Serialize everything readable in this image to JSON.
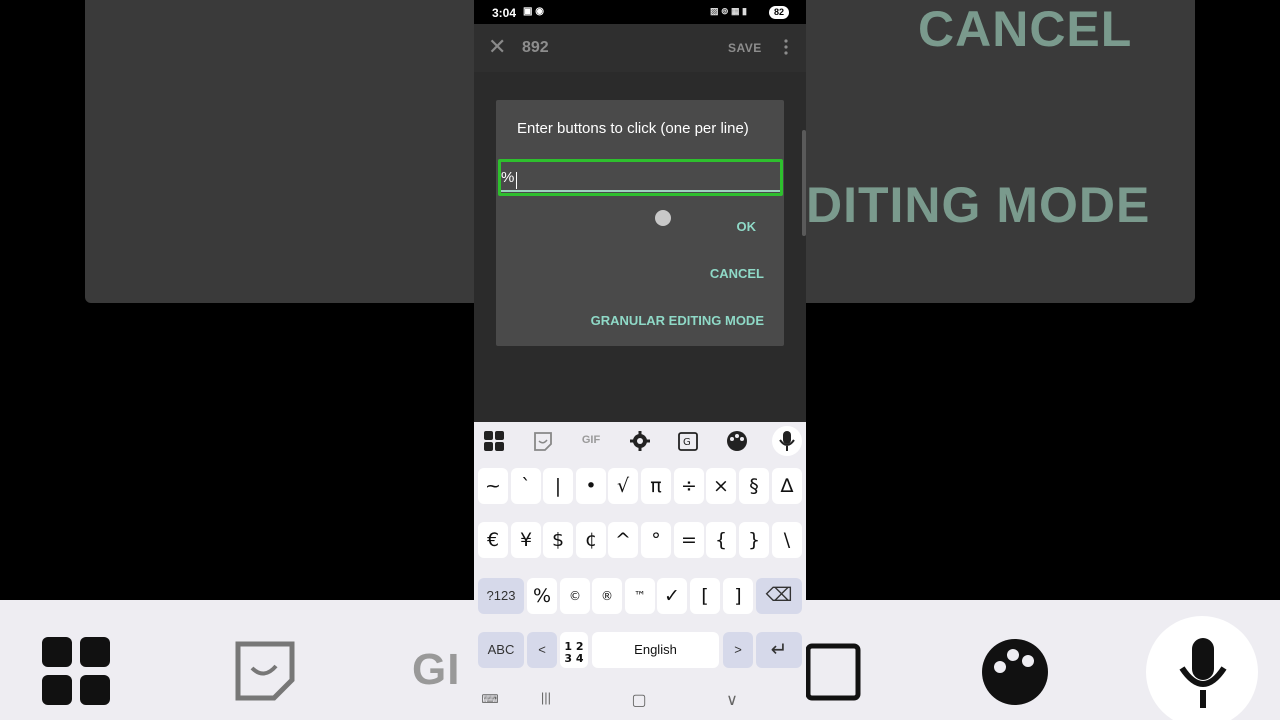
{
  "status_bar": {
    "time": "3:04",
    "left_icons": "▣ ◉",
    "right_icons": "▨ ⊚ ▦ ▮",
    "battery": "82"
  },
  "app_bar": {
    "close_glyph": "✕",
    "title": "892",
    "save_label": "SAVE",
    "more_glyph": "⋮"
  },
  "dialog": {
    "title": "Enter buttons to click (one per line)",
    "input_value": "%",
    "ok_label": "OK",
    "cancel_label": "CANCEL",
    "granular_label": "GRANULAR EDITING MODE",
    "accent_color": "#8fd9c7",
    "focus_color": "#2ec02e"
  },
  "background": {
    "cancel_text": "CANCEL",
    "editing_text": "DITING MODE"
  },
  "keyboard": {
    "toolbar": {
      "gif_label": "GIF"
    },
    "row1": [
      "~",
      "`",
      "|",
      "•",
      "√",
      "π",
      "÷",
      "×",
      "§",
      "∆"
    ],
    "row2": [
      "€",
      "¥",
      "$",
      "¢",
      "^",
      "°",
      "=",
      "{",
      "}",
      "\\"
    ],
    "row3": {
      "mode_label": "?123",
      "keys": [
        "%",
        "©",
        "®",
        "™",
        "✓",
        "[",
        "]"
      ],
      "backspace_glyph": "⌫"
    },
    "row4": {
      "abc_label": "ABC",
      "left_label": "<",
      "stack_top": "1 2",
      "stack_bottom": "3 4",
      "space_label": "English",
      "right_label": ">",
      "enter_glyph": "↵"
    }
  },
  "nav_bar": {
    "keyboard_glyph": "⌨",
    "recents_glyph": "|||",
    "home_glyph": "▢",
    "back_glyph": "∨"
  }
}
